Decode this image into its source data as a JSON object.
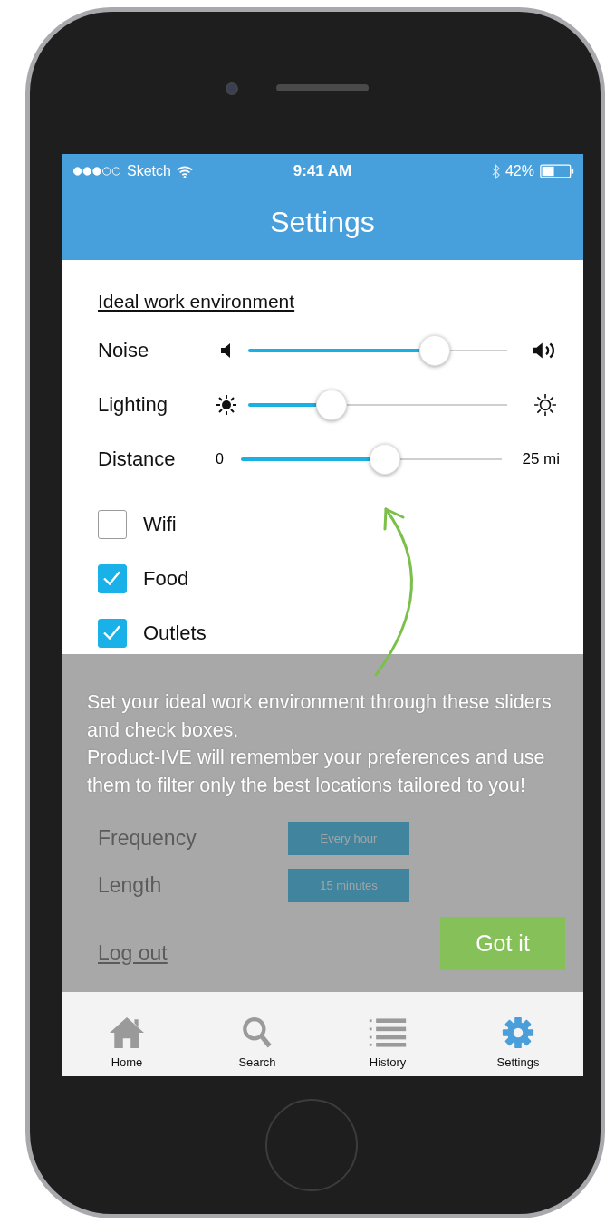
{
  "status_bar": {
    "carrier": "Sketch",
    "time": "9:41 AM",
    "battery": "42%"
  },
  "nav_bar": {
    "title": "Settings"
  },
  "section_title": "Ideal work environment",
  "sliders": [
    {
      "label": "Noise",
      "kind": "volume",
      "level": 0.72
    },
    {
      "label": "Lighting",
      "kind": "brightness",
      "level": 0.32
    },
    {
      "label": "Distance",
      "kind": "range",
      "min": "0",
      "max": "25 mi",
      "level": 0.55
    }
  ],
  "checkboxes": [
    {
      "label": "Wifi",
      "checked": false
    },
    {
      "label": "Food",
      "checked": true
    },
    {
      "label": "Outlets",
      "checked": true
    }
  ],
  "break_settings": [
    {
      "label": "Frequency",
      "value": "Every hour"
    },
    {
      "label": "Length",
      "value": "15 minutes"
    }
  ],
  "log_out": "Log out",
  "coach_mark": {
    "paragraphs": [
      "Set your ideal work environment through these sliders and check boxes.",
      "Product-IVE will remember your preferences and use them to filter only the best locations tailored to you!"
    ],
    "button": "Got it"
  },
  "tab_bar": [
    {
      "label": "Home",
      "kind": "home",
      "selected": false
    },
    {
      "label": "Search",
      "kind": "search",
      "selected": false
    },
    {
      "label": "History",
      "kind": "history",
      "selected": false
    },
    {
      "label": "Settings",
      "kind": "settings",
      "selected": true
    }
  ]
}
